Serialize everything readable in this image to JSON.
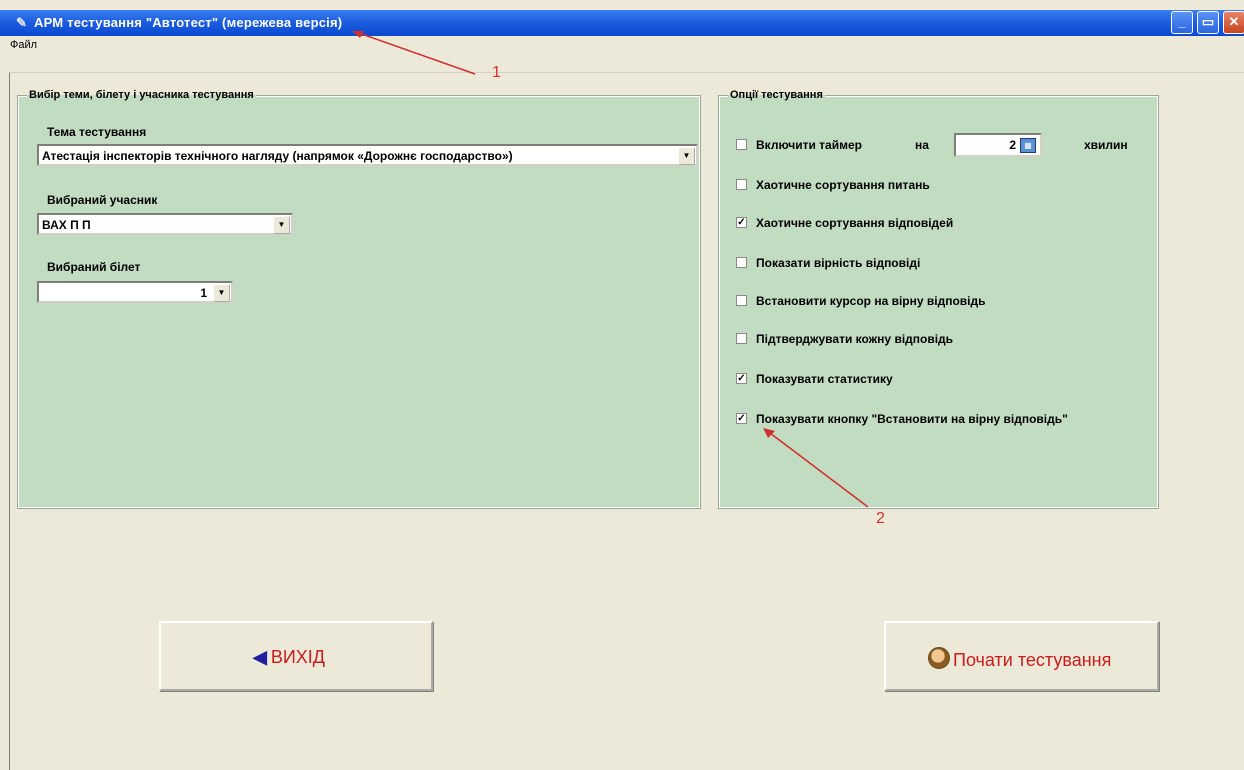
{
  "window": {
    "title": "АРМ тестування \"Автотест\" (мережева версія)",
    "controls": [
      "_",
      "▭",
      "✕"
    ]
  },
  "menu": {
    "items": [
      {
        "label": "Файл"
      }
    ]
  },
  "selection_panel": {
    "title": "Вибір теми, білету і учасника тестування",
    "topic_label": "Тема тестування",
    "topic_value": "Атестація інспекторів технічного нагляду (напрямок «Дорожнє господарство»)",
    "participant_label": "Вибраний учасник",
    "participant_value": "ВАХ П П",
    "ticket_label": "Вибраний білет",
    "ticket_value": "1"
  },
  "options_panel": {
    "title": "Опції тестування",
    "timer": {
      "label": "Включити таймер",
      "on_label": "на",
      "minutes": "2",
      "unit": "хвилин",
      "checked": false
    },
    "items": [
      {
        "label": "Хаотичне сортування питань",
        "checked": false
      },
      {
        "label": "Хаотичне сортування відповідей",
        "checked": true
      },
      {
        "label": "Показати вірність відповіді",
        "checked": false
      },
      {
        "label": "Встановити курсор на вірну відповідь",
        "checked": false
      },
      {
        "label": "Підтверджувати кожну відповідь",
        "checked": false
      },
      {
        "label": "Показувати статистику",
        "checked": true
      },
      {
        "label": "Показувати кнопку \"Встановити на вірну відповідь\"",
        "checked": true
      }
    ]
  },
  "buttons": {
    "exit_label": "ВИХІД",
    "start_label": "Почати тестування"
  },
  "annotations": {
    "label_1": "1",
    "label_2": "2",
    "color": "#d03030"
  },
  "colors": {
    "panel_bg": "#c2dcc2",
    "titlebar": "#0a49d0",
    "button_text": "#c81c1c"
  }
}
